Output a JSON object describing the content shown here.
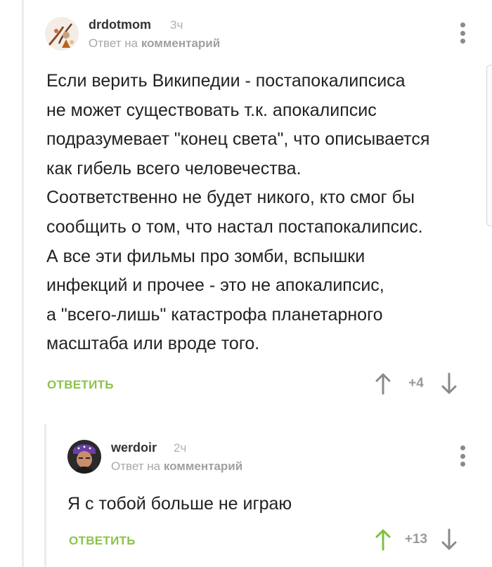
{
  "comments": [
    {
      "username": "drdotmom",
      "time": "3ч",
      "reply_prefix": "Ответ на",
      "reply_link": "комментарий",
      "text_lines": [
        "Если верить Википедии - постапокалипсиса",
        "не может существовать т.к. апокалипсис",
        "подразумевает \"конец света\", что описывается",
        "как гибель всего человечества.",
        "Соответственно не будет никого, кто смог бы",
        "сообщить о том, что настал постапокалипсис.",
        "А все эти фильмы про зомби, вспышки",
        "инфекций и прочее - это не апокалипсис,",
        "а \"всего-лишь\" катастрофа планетарного",
        "масштаба или вроде того."
      ],
      "reply_label": "ОТВЕТИТЬ",
      "score": "+4",
      "upvoted": false
    },
    {
      "username": "werdoir",
      "time": "2ч",
      "reply_prefix": "Ответ на",
      "reply_link": "комментарий",
      "text_lines": [
        "Я с тобой больше не играю"
      ],
      "reply_label": "ОТВЕТИТЬ",
      "score": "+13",
      "upvoted": true
    }
  ],
  "colors": {
    "accent_green": "#8bc34a",
    "muted_gray": "#9a9a9a"
  },
  "icons": [
    "avatar",
    "more-vertical-icon",
    "arrow-up-icon",
    "arrow-down-icon"
  ]
}
